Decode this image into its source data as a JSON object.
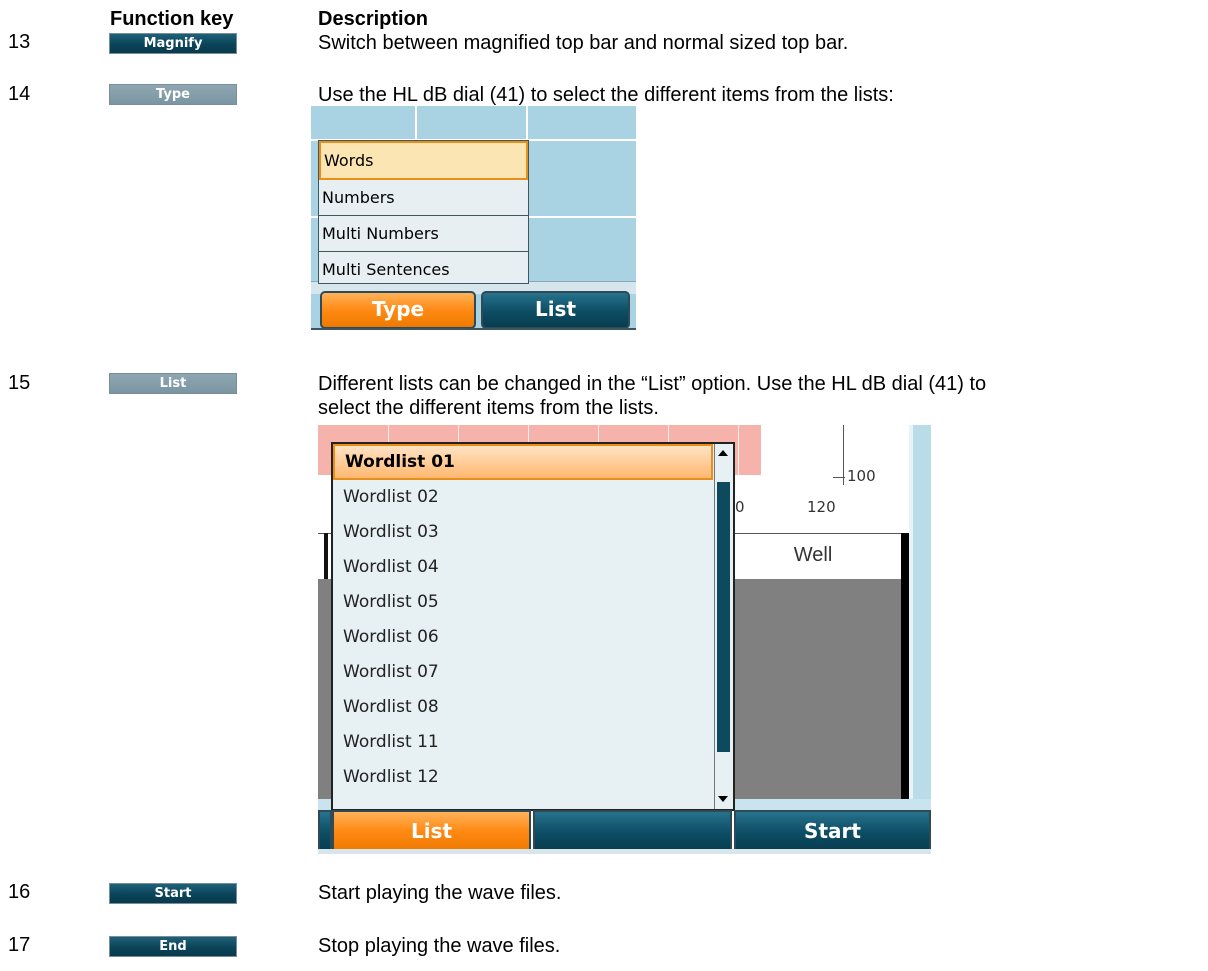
{
  "headers": {
    "function_key": "Function key",
    "description": "Description"
  },
  "rows": [
    {
      "number": "13",
      "key_label": "Magnify",
      "description": "Switch between magnified top bar and normal sized top bar."
    },
    {
      "number": "14",
      "key_label": "Type",
      "description": "Use the HL dB dial (41) to select the different items from the lists:"
    },
    {
      "number": "15",
      "key_label": "List",
      "description_line1": "Different lists can be changed in the “List” option. Use the HL dB dial (41) to",
      "description_line2": "select the different items from the lists."
    },
    {
      "number": "16",
      "key_label": "Start",
      "description": "Start playing the wave files."
    },
    {
      "number": "17",
      "key_label": "End",
      "description": "Stop playing the wave files."
    }
  ],
  "type_screen": {
    "options": [
      "Words",
      "Numbers",
      "Multi Numbers",
      "Multi Sentences"
    ],
    "selected": "Words",
    "buttons": [
      "Type",
      "List"
    ]
  },
  "list_screen": {
    "axis_labels": [
      "100",
      "120",
      "0"
    ],
    "column_header": "Well",
    "options": [
      "Wordlist 01",
      "Wordlist 02",
      "Wordlist 03",
      "Wordlist 04",
      "Wordlist 05",
      "Wordlist 06",
      "Wordlist 07",
      "Wordlist 08",
      "Wordlist 11",
      "Wordlist 12"
    ],
    "selected": "Wordlist 01",
    "buttons": [
      "List",
      "",
      "Start"
    ]
  },
  "colors": {
    "button_dark": "#0b4459",
    "button_grey": "#7b96a3",
    "accent_orange": "#ff8a14",
    "screen_blue": "#a9d2e2",
    "pink_area": "#f6b3ac"
  }
}
